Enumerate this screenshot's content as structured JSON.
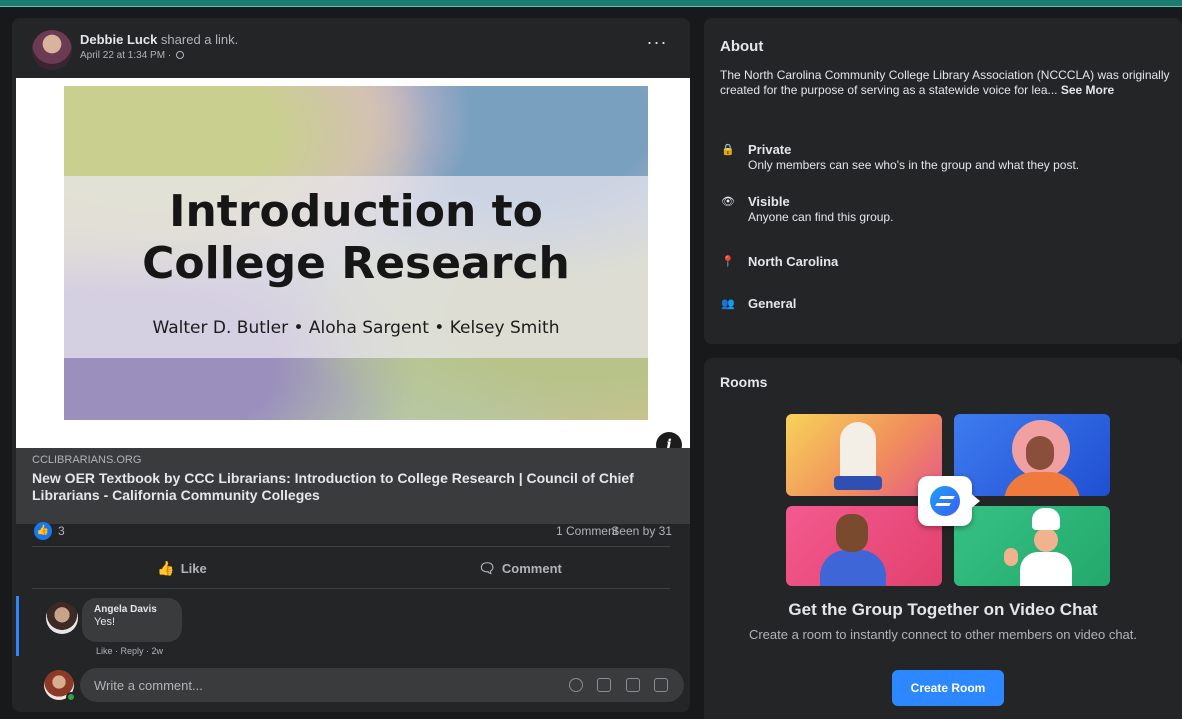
{
  "post": {
    "author": "Debbie Luck",
    "action": "shared a link.",
    "timestamp": "April 22 at 1:34 PM · ",
    "more_label": "···",
    "link_image": {
      "title_line1": "Introduction to",
      "title_line2": "College Research",
      "authors": "Walter D. Butler • Aloha Sargent • Kelsey Smith",
      "info_label": "i"
    },
    "link_domain": "CCLIBRARIANS.ORG",
    "link_title": "New OER Textbook by CCC Librarians: Introduction to College Research | Council of Chief Librarians - California Community Colleges",
    "reactions_count": "3",
    "comments_count": "1 Comment",
    "seen_by": "Seen by 31",
    "like_label": "Like",
    "comment_label": "Comment",
    "comment": {
      "author": "Angela Davis",
      "text": "Yes!",
      "actions": "Like · Reply · 2w"
    },
    "write_comment_placeholder": "Write a comment..."
  },
  "about": {
    "title": "About",
    "description": "The North Carolina Community College Library Association (NCCCLA) was originally created for the purpose of serving as a statewide voice for lea...",
    "see_more": "See More",
    "privacy_label": "Private",
    "privacy_sub": "Only members can see who's in the group and what they post.",
    "visibility_label": "Visible",
    "visibility_sub": "Anyone can find this group.",
    "location": "North Carolina",
    "category": "General"
  },
  "rooms": {
    "title": "Rooms",
    "heading": "Get the Group Together on Video Chat",
    "subtext": "Create a room to instantly connect to other members on video chat.",
    "create_button": "Create Room"
  },
  "colors": {
    "accent": "#2d88ff",
    "card_bg": "#242526",
    "page_bg": "#18191a",
    "top_accent": "#1c7b6e"
  }
}
